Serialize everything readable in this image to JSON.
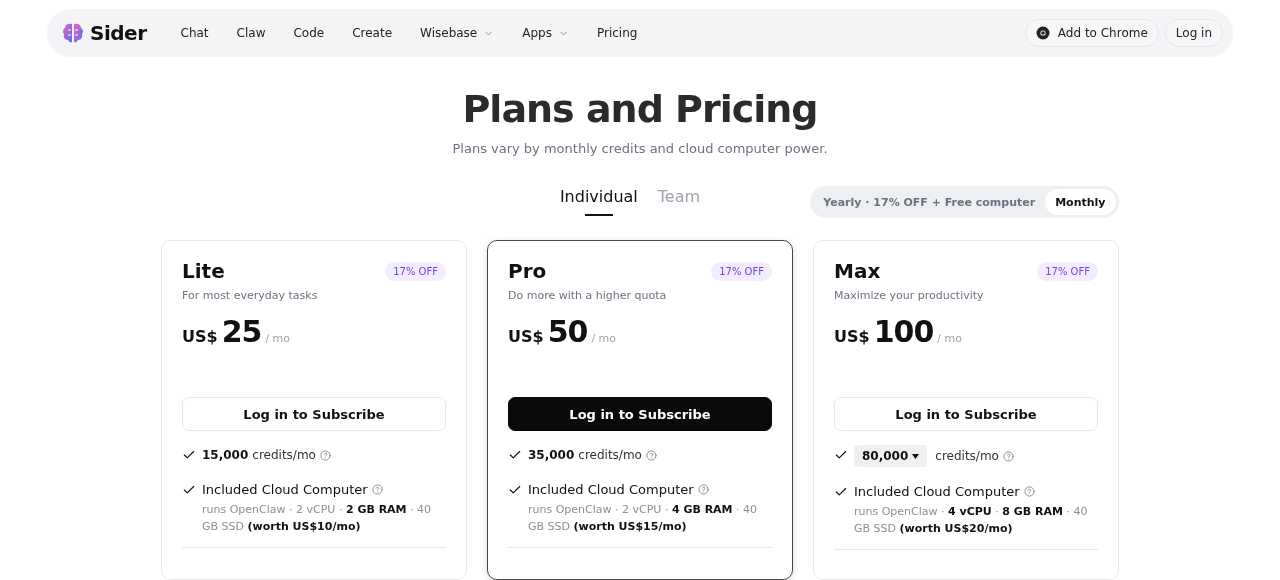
{
  "nav": {
    "logo": "Sider",
    "items": [
      {
        "label": "Chat",
        "kind": "link"
      },
      {
        "label": "Claw",
        "kind": "link"
      },
      {
        "label": "Code",
        "kind": "link"
      },
      {
        "label": "Create",
        "kind": "link"
      },
      {
        "label": "Wisebase",
        "kind": "menu"
      },
      {
        "label": "Apps",
        "kind": "menu"
      },
      {
        "label": "Pricing",
        "kind": "link"
      }
    ],
    "add_to_chrome": "Add to Chrome",
    "login": "Log in"
  },
  "title": "Plans and Pricing",
  "subtitle": "Plans vary by monthly credits and cloud computer power.",
  "tabs": [
    {
      "label": "Individual",
      "selected": true
    },
    {
      "label": "Team",
      "selected": false
    }
  ],
  "billing": [
    {
      "label": "Yearly · 17% OFF + Free computer",
      "selected": false
    },
    {
      "label": "Monthly",
      "selected": true
    }
  ],
  "plans": [
    {
      "name": "Lite",
      "badge": "17% OFF",
      "tagline": "For most everyday tasks",
      "currency": "US$",
      "amount": "25",
      "period": "/ mo",
      "button": "Log in to Subscribe",
      "highlighted": false,
      "credits": {
        "kind": "text",
        "amount": "15,000",
        "label": "credits/mo"
      },
      "computer": {
        "title": "Included Cloud Computer",
        "details": "runs OpenClaw · 2 vCPU · **2 GB RAM** · 40 GB SSD **(worth US$10/mo)**"
      }
    },
    {
      "name": "Pro",
      "badge": "17% OFF",
      "tagline": "Do more with a higher quota",
      "currency": "US$",
      "amount": "50",
      "period": "/ mo",
      "button": "Log in to Subscribe",
      "highlighted": true,
      "credits": {
        "kind": "text",
        "amount": "35,000",
        "label": "credits/mo"
      },
      "computer": {
        "title": "Included Cloud Computer",
        "details": "runs OpenClaw · 2 vCPU · **4 GB RAM** · 40 GB SSD **(worth US$15/mo)**"
      }
    },
    {
      "name": "Max",
      "badge": "17% OFF",
      "tagline": "Maximize your productivity",
      "currency": "US$",
      "amount": "100",
      "period": "/ mo",
      "button": "Log in to Subscribe",
      "highlighted": false,
      "credits": {
        "kind": "select",
        "amount": "80,000",
        "label": "credits/mo"
      },
      "computer": {
        "title": "Included Cloud Computer",
        "details": "runs OpenClaw · **4 vCPU** · **8 GB RAM** · 40 GB SSD **(worth US$20/mo)**"
      }
    }
  ]
}
